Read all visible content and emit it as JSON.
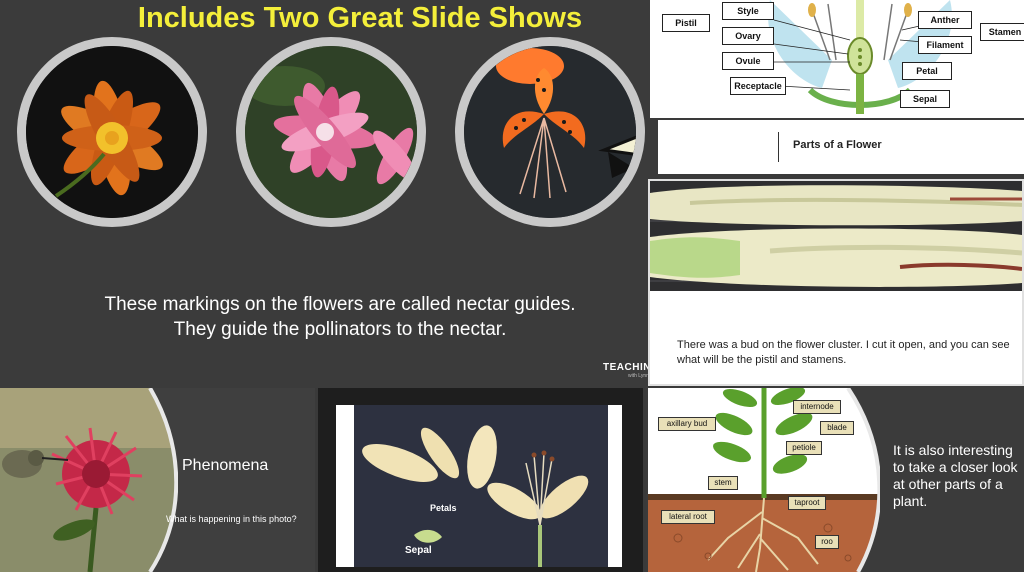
{
  "main_slide": {
    "title": "Includes Two Great Slide Shows",
    "caption": "These markings on the flowers are called nectar guides. They guide the pollinators to the nectar.",
    "brand": "TEACHING S",
    "brand_sub": "with Lynn"
  },
  "parts_slide": {
    "labels": {
      "pistil": "Pistil",
      "style": "Style",
      "ovary": "Ovary",
      "ovule": "Ovule",
      "receptacle": "Receptacle",
      "anther": "Anther",
      "filament": "Filament",
      "stamen": "Stamen",
      "petal": "Petal",
      "sepal": "Sepal"
    },
    "title": "Parts of a Flower"
  },
  "bud_slide": {
    "caption": "There was a bud on the flower cluster.  I cut it open, and you can see what will be the pistil and stamens."
  },
  "phenomena_slide": {
    "title": "Phenomena",
    "question": "What is happening in this photo?"
  },
  "petals_slide": {
    "petals_label": "Petals",
    "sepal_label": "Sepal"
  },
  "plant_slide": {
    "labels": {
      "axillary_bud": "axillary bud",
      "internode": "internode",
      "blade": "blade",
      "petiole": "petiole",
      "stem": "stem",
      "taproot": "taproot",
      "lateral_root": "lateral root",
      "root": "roo"
    },
    "caption": "It is also interesting to take a closer look at other parts of a plant."
  },
  "colors": {
    "title_yellow": "#f4ef3a",
    "slide_gray": "#3b3b3b",
    "frame_gray": "#c9c9c9",
    "soil_brown": "#b5643c",
    "leaf_green": "#5aa02c"
  }
}
